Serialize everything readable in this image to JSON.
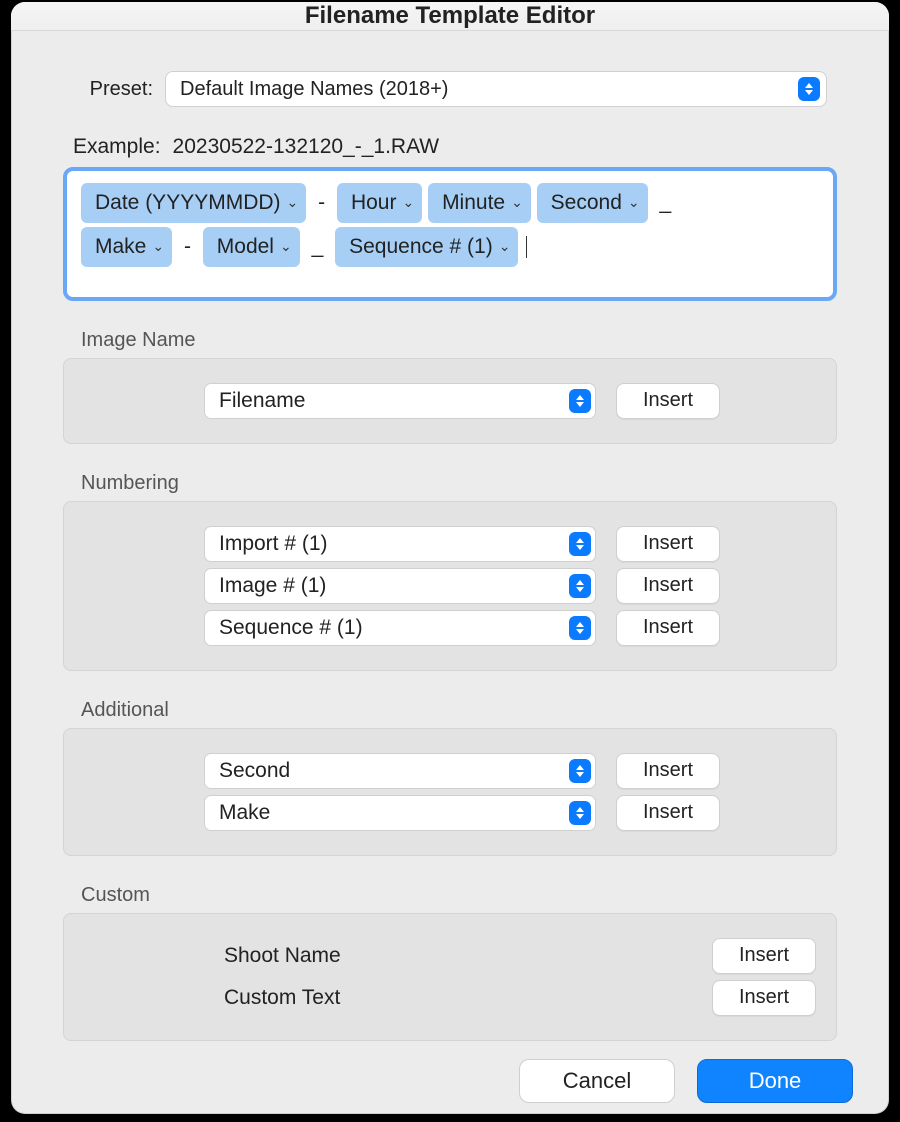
{
  "title": "Filename Template Editor",
  "preset": {
    "label": "Preset:",
    "value": "Default Image Names (2018+)"
  },
  "example": {
    "label": "Example:",
    "value": "20230522-132120_-_1.RAW"
  },
  "tokens": [
    {
      "label": "Date (YYYYMMDD)"
    },
    {
      "sep": "-"
    },
    {
      "label": "Hour"
    },
    {
      "label": "Minute"
    },
    {
      "label": "Second"
    },
    {
      "sep": "_"
    },
    {
      "break": true
    },
    {
      "label": "Make"
    },
    {
      "sep": "-"
    },
    {
      "label": "Model"
    },
    {
      "sep": "_"
    },
    {
      "label": "Sequence # (1)"
    }
  ],
  "sections": {
    "imageName": {
      "title": "Image Name",
      "rows": [
        {
          "select": "Filename",
          "insert": "Insert"
        }
      ]
    },
    "numbering": {
      "title": "Numbering",
      "rows": [
        {
          "select": "Import # (1)",
          "insert": "Insert"
        },
        {
          "select": "Image # (1)",
          "insert": "Insert"
        },
        {
          "select": "Sequence # (1)",
          "insert": "Insert"
        }
      ]
    },
    "additional": {
      "title": "Additional",
      "rows": [
        {
          "select": "Second",
          "insert": "Insert"
        },
        {
          "select": "Make",
          "insert": "Insert"
        }
      ]
    },
    "custom": {
      "title": "Custom",
      "rows": [
        {
          "label": "Shoot Name",
          "insert": "Insert"
        },
        {
          "label": "Custom Text",
          "insert": "Insert"
        }
      ]
    }
  },
  "footer": {
    "cancel": "Cancel",
    "done": "Done"
  }
}
